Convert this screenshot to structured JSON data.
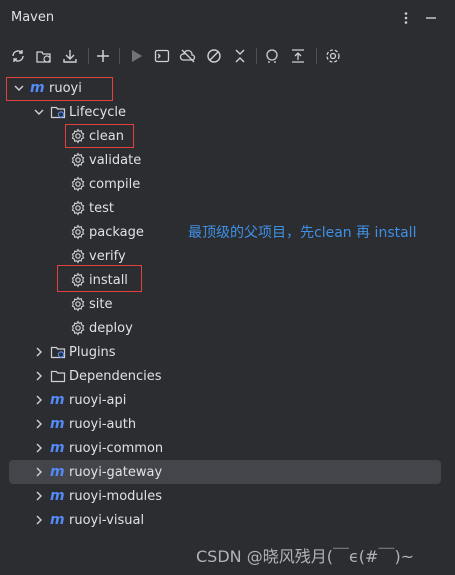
{
  "window": {
    "title": "Maven"
  },
  "toolbar_icons": [
    "reload-icon",
    "generate-sources-icon",
    "download-icon",
    "add-icon",
    "run-icon",
    "execute-goal-icon",
    "offline-icon",
    "skip-tests-icon",
    "collapse-icon",
    "analyze-deps-icon",
    "show-deps-icon",
    "settings-icon"
  ],
  "tree": {
    "root": {
      "label": "ruoyi"
    },
    "lifecycle": {
      "label": "Lifecycle",
      "goals": [
        "clean",
        "validate",
        "compile",
        "test",
        "package",
        "verify",
        "install",
        "site",
        "deploy"
      ]
    },
    "plugins": {
      "label": "Plugins"
    },
    "dependencies": {
      "label": "Dependencies"
    },
    "modules": [
      "ruoyi-api",
      "ruoyi-auth",
      "ruoyi-common",
      "ruoyi-gateway",
      "ruoyi-modules",
      "ruoyi-visual"
    ],
    "selected_module": "ruoyi-gateway"
  },
  "annotation": "最顶级的父项目，先clean 再 install",
  "watermark": "CSDN @晓风残月(￣ϵ(#￣)~",
  "colors": {
    "background": "#2b2d30",
    "accent": "#548af7",
    "highlight_box": "#e0413f",
    "annotation": "#3f90e6",
    "selected_row": "#43454a"
  }
}
